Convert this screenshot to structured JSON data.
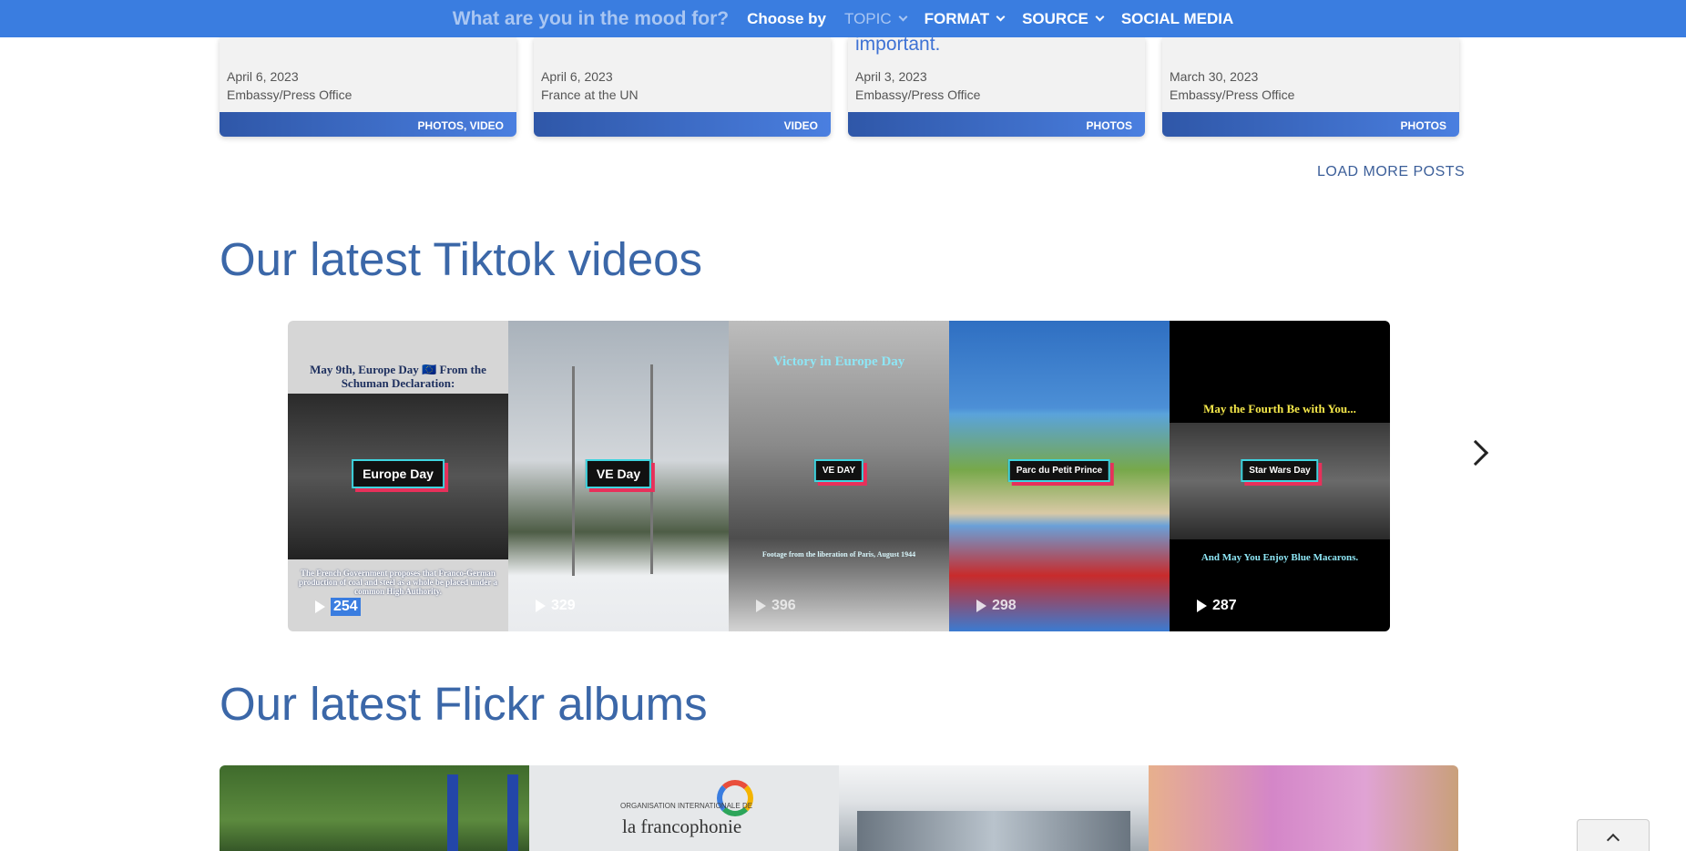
{
  "topbar": {
    "mood": "What are you in the mood for?",
    "choose_by": "Choose by",
    "menus": [
      {
        "label": "TOPIC"
      },
      {
        "label": "FORMAT"
      },
      {
        "label": "SOURCE"
      },
      {
        "label": "SOCIAL MEDIA"
      }
    ]
  },
  "posts": [
    {
      "partial_title": "",
      "date": "April 6, 2023",
      "source": "Embassy/Press Office",
      "tags": "PHOTOS, VIDEO"
    },
    {
      "partial_title": "",
      "date": "April 6, 2023",
      "source": "France at the UN",
      "tags": "VIDEO"
    },
    {
      "partial_title": "important.",
      "date": "April 3, 2023",
      "source": "Embassy/Press Office",
      "tags": "PHOTOS"
    },
    {
      "partial_title": "",
      "date": "March 30, 2023",
      "source": "Embassy/Press Office",
      "tags": "PHOTOS"
    }
  ],
  "load_more": "LOAD MORE POSTS",
  "tiktok": {
    "title": "Our latest Tiktok videos",
    "videos": [
      {
        "caption_top": "May 9th, Europe Day 🇪🇺 From the Schuman Declaration:",
        "badge": "Europe Day",
        "caption_bottom": "The French Government proposes that Franco-German production of coal and steel as a whole be placed under a common High Authority.",
        "views": "254",
        "bg_top": "#dcdcdc",
        "bg_bottom": "#d9d9d9"
      },
      {
        "caption_top": "",
        "badge": "VE Day",
        "caption_bottom": "",
        "views": "329",
        "bg_top": "#c9ced3",
        "bg_bottom": "#f2f2f2"
      },
      {
        "caption_top": "Victory in Europe Day",
        "badge": "VE DAY",
        "caption_bottom": "Footage from the liberation of Paris, August 1944",
        "views": "396",
        "bg_top": "#cfcfcf",
        "bg_bottom": "#bdbdbd"
      },
      {
        "caption_top": "",
        "badge": "Parc du Petit Prince",
        "caption_bottom": "",
        "views": "298",
        "bg_top": "#3b7bd1",
        "bg_bottom": "#4aa0d9"
      },
      {
        "caption_top": "May the Fourth Be with You...",
        "badge": "Star Wars Day",
        "caption_bottom": "And May You Enjoy Blue Macarons.",
        "views": "287",
        "bg_top": "#000000",
        "bg_bottom": "#000000"
      }
    ]
  },
  "flickr": {
    "title": "Our latest Flickr albums",
    "albums": [
      {
        "org_line": "",
        "org_name": ""
      },
      {
        "org_line": "ORGANISATION INTERNATIONALE DE",
        "org_name": "la francophonie"
      },
      {
        "org_line": "",
        "org_name": ""
      },
      {
        "org_line": "",
        "org_name": ""
      }
    ]
  },
  "colors": {
    "topbar": "#3a7de0",
    "heading": "#3b67a8",
    "tag_band_start": "#2f57a8",
    "tag_band_end": "#4a7fe0"
  },
  "icons": {
    "menu_chevron": "chevron-down-icon",
    "carousel_next": "chevron-right-icon",
    "play": "play-icon",
    "back_to_top": "chevron-up-icon"
  }
}
